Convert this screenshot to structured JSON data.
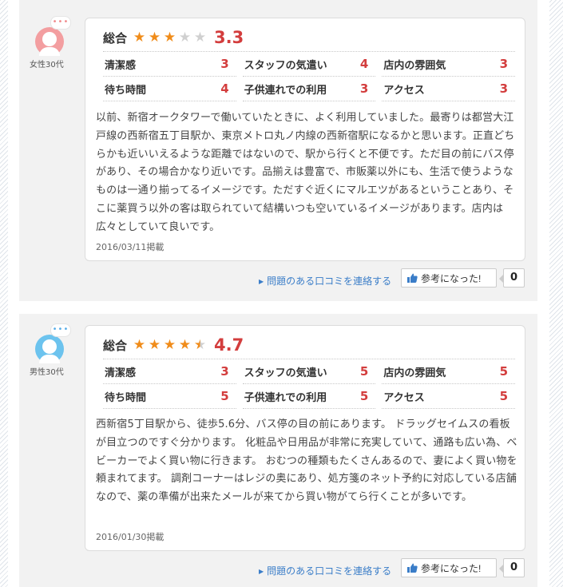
{
  "reviews": [
    {
      "reviewer": "女性30代",
      "gender": "female",
      "bubble": "•••",
      "overall_label": "総合",
      "rating": 3.3,
      "stars_filled": 3,
      "stars_half": 0,
      "score": "3.3",
      "sub_ratings": [
        {
          "label": "清潔感",
          "value": "3"
        },
        {
          "label": "スタッフの気遣い",
          "value": "4"
        },
        {
          "label": "店内の雰囲気",
          "value": "3"
        },
        {
          "label": "待ち時間",
          "value": "4"
        },
        {
          "label": "子供連れでの利用",
          "value": "3"
        },
        {
          "label": "アクセス",
          "value": "3"
        }
      ],
      "text": "以前、新宿オークタワーで働いていたときに、よく利用していました。最寄りは都営大江戸線の西新宿五丁目駅か、東京メトロ丸ノ内線の西新宿駅になるかと思います。正直どちらかも近いいえるような距離ではないので、駅から行くと不便です。ただ目の前にバス停があり、その場合かなり近いです。品揃えは豊富で、市販薬以外にも、生活で使うようなものは一通り揃ってるイメージです。ただすぐ近くにマルエツがあるということあり、そこに薬買う以外の客は取られていて結構いつも空いているイメージがあります。店内は広々としていて良いです。",
      "date": "2016/03/11掲載",
      "report_label": "問題のある口コミを連絡する",
      "helpful_label": "参考になった!",
      "helpful_count": "0"
    },
    {
      "reviewer": "男性30代",
      "gender": "male",
      "bubble": "•••",
      "overall_label": "総合",
      "rating": 4.7,
      "stars_filled": 4,
      "stars_half": 1,
      "score": "4.7",
      "sub_ratings": [
        {
          "label": "清潔感",
          "value": "3"
        },
        {
          "label": "スタッフの気遣い",
          "value": "5"
        },
        {
          "label": "店内の雰囲気",
          "value": "5"
        },
        {
          "label": "待ち時間",
          "value": "5"
        },
        {
          "label": "子供連れでの利用",
          "value": "5"
        },
        {
          "label": "アクセス",
          "value": "5"
        }
      ],
      "text": "西新宿5丁目駅から、徒歩5.6分、バス停の目の前にあります。 ドラッグセイムスの看板が目立つのですぐ分かります。 化粧品や日用品が非常に充実していて、通路も広い為、ベビーカーでよく買い物に行きます。 おむつの種類もたくさんあるので、妻によく買い物を頼まれてます。 調剤コーナーはレジの奥にあり、処方箋のネット予約に対応している店舗なので、薬の準備が出来たメールが来てから買い物がてら行くことが多いです。",
      "date": "2016/01/30掲載",
      "report_label": "問題のある口コミを連絡する",
      "helpful_label": "参考になった!",
      "helpful_count": "0"
    }
  ],
  "colors": {
    "accent_score": "#d33d3d",
    "star": "#f08c1a",
    "link": "#3a7dc8",
    "female_avatar": "#f39ea0",
    "male_avatar": "#6cc3ee"
  }
}
